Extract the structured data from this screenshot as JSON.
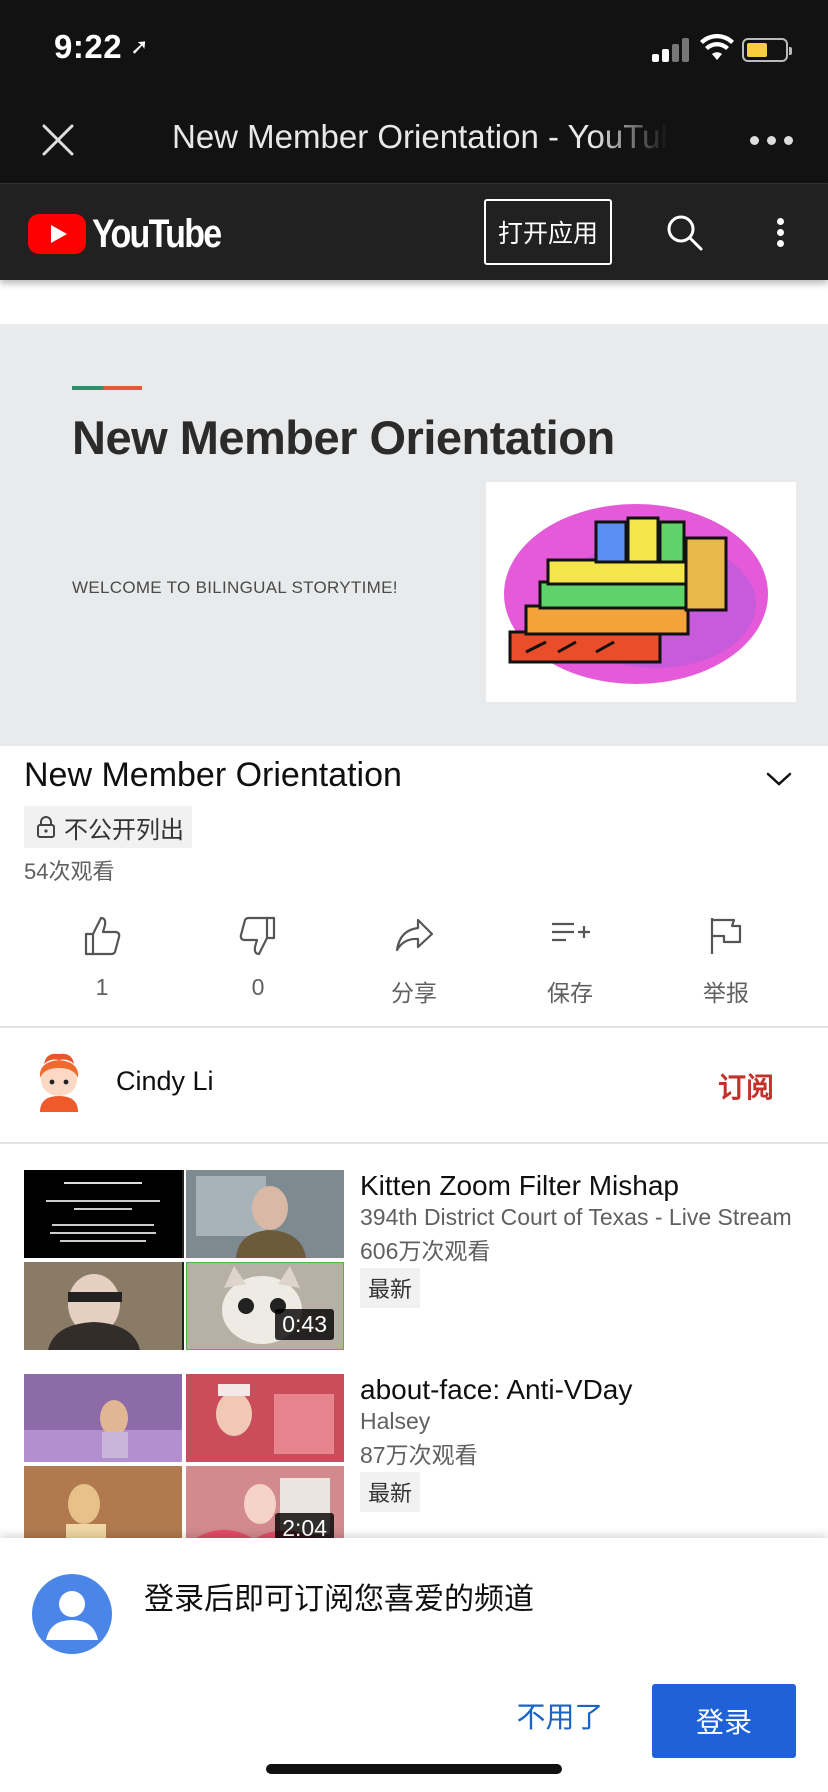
{
  "status_bar": {
    "time": "9:22",
    "battery_color": "#f7cf3e"
  },
  "browser": {
    "title": "New Member Orientation - YouTube"
  },
  "header": {
    "open_app_label": "打开应用"
  },
  "player": {
    "slide_title": "New Member Orientation",
    "slide_subtitle": "WELCOME TO BILINGUAL STORYTIME!"
  },
  "video": {
    "title": "New Member Orientation",
    "privacy_label": "不公开列出",
    "views": "54次观看"
  },
  "actions": [
    {
      "icon": "thumbs-up-icon",
      "label": "1"
    },
    {
      "icon": "thumbs-down-icon",
      "label": "0"
    },
    {
      "icon": "share-icon",
      "label": "分享"
    },
    {
      "icon": "save-playlist-icon",
      "label": "保存"
    },
    {
      "icon": "flag-icon",
      "label": "举报"
    }
  ],
  "channel": {
    "name": "Cindy Li",
    "subscribe_label": "订阅"
  },
  "related": [
    {
      "title": "Kitten Zoom Filter Mishap",
      "channel": "394th District Court of Texas - Live Stream",
      "views": "606万次观看",
      "badge": "最新",
      "duration": "0:43"
    },
    {
      "title": "about-face: Anti-VDay",
      "channel": "Halsey",
      "views": "87万次观看",
      "badge": "最新",
      "duration": "2:04"
    }
  ],
  "signin_sheet": {
    "message": "登录后即可订阅您喜爱的频道",
    "dismiss_label": "不用了",
    "signin_label": "登录"
  },
  "colors": {
    "accent_red": "#c4302b",
    "signin_blue": "#1f62d8",
    "youtube_red": "#ff0000"
  }
}
